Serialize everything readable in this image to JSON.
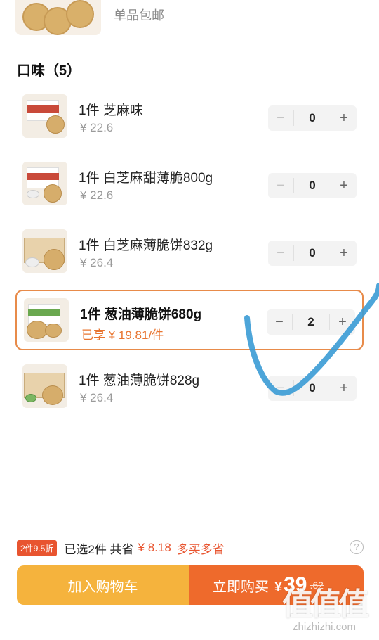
{
  "header": {
    "caption": "单品包邮"
  },
  "section": {
    "title": "口味（5）"
  },
  "items": [
    {
      "name": "1件 芝麻味",
      "price": "¥ 22.6",
      "qty": "0",
      "minus": "−",
      "plus": "+"
    },
    {
      "name": "1件 白芝麻甜薄脆800g",
      "price": "¥ 22.6",
      "qty": "0",
      "minus": "−",
      "plus": "+"
    },
    {
      "name": "1件 白芝麻薄脆饼832g",
      "price": "¥ 26.4",
      "qty": "0",
      "minus": "−",
      "plus": "+"
    },
    {
      "name": "1件 葱油薄脆饼680g",
      "price": "已享 ¥ 19.81/件",
      "qty": "2",
      "minus": "−",
      "plus": "+"
    },
    {
      "name": "1件 葱油薄脆饼828g",
      "price": "¥ 26.4",
      "qty": "0",
      "minus": "−",
      "plus": "+"
    }
  ],
  "summary": {
    "promo_tag": "2件9.5折",
    "selected_text": "已选2件 共省",
    "saved_amount": "¥ 8.18",
    "more_text": "多买多省",
    "help_icon": "?"
  },
  "buttons": {
    "add_to_cart": "加入购物车",
    "buy_now": "立即购买",
    "currency": "¥",
    "buy_price": "39",
    "buy_price_orig": ".62"
  },
  "watermark": {
    "logo": "值值值",
    "url": "zhizhizhi.com"
  },
  "colors": {
    "accent": "#ee6a2c",
    "cart": "#f5b33d",
    "highlight_border": "#e88b4a",
    "annotation": "#3a9bd5"
  }
}
